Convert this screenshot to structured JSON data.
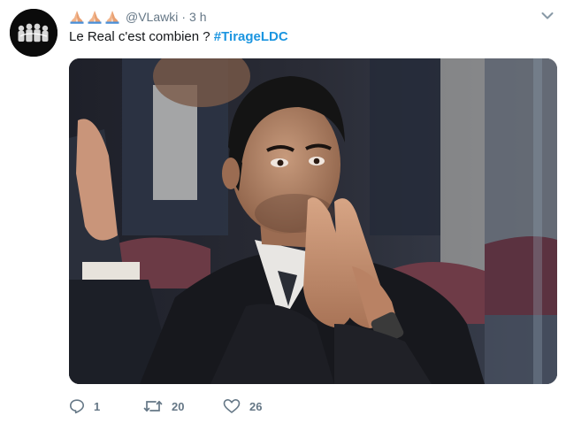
{
  "tweet": {
    "author_emoji": "🙏🙏🙏",
    "handle": "@VLawki",
    "separator": "·",
    "time": "3 h",
    "text_plain": "Le Real c'est combien ? ",
    "hashtag": "#TirageLDC",
    "avatar_icon": "avatar-group-icon",
    "menu_icon": "chevron-down-icon"
  },
  "actions": {
    "reply_count": "1",
    "retweet_count": "20",
    "like_count": "26"
  },
  "colors": {
    "hashtag": "#1b95e0",
    "muted": "#657786",
    "text": "#14171a"
  }
}
